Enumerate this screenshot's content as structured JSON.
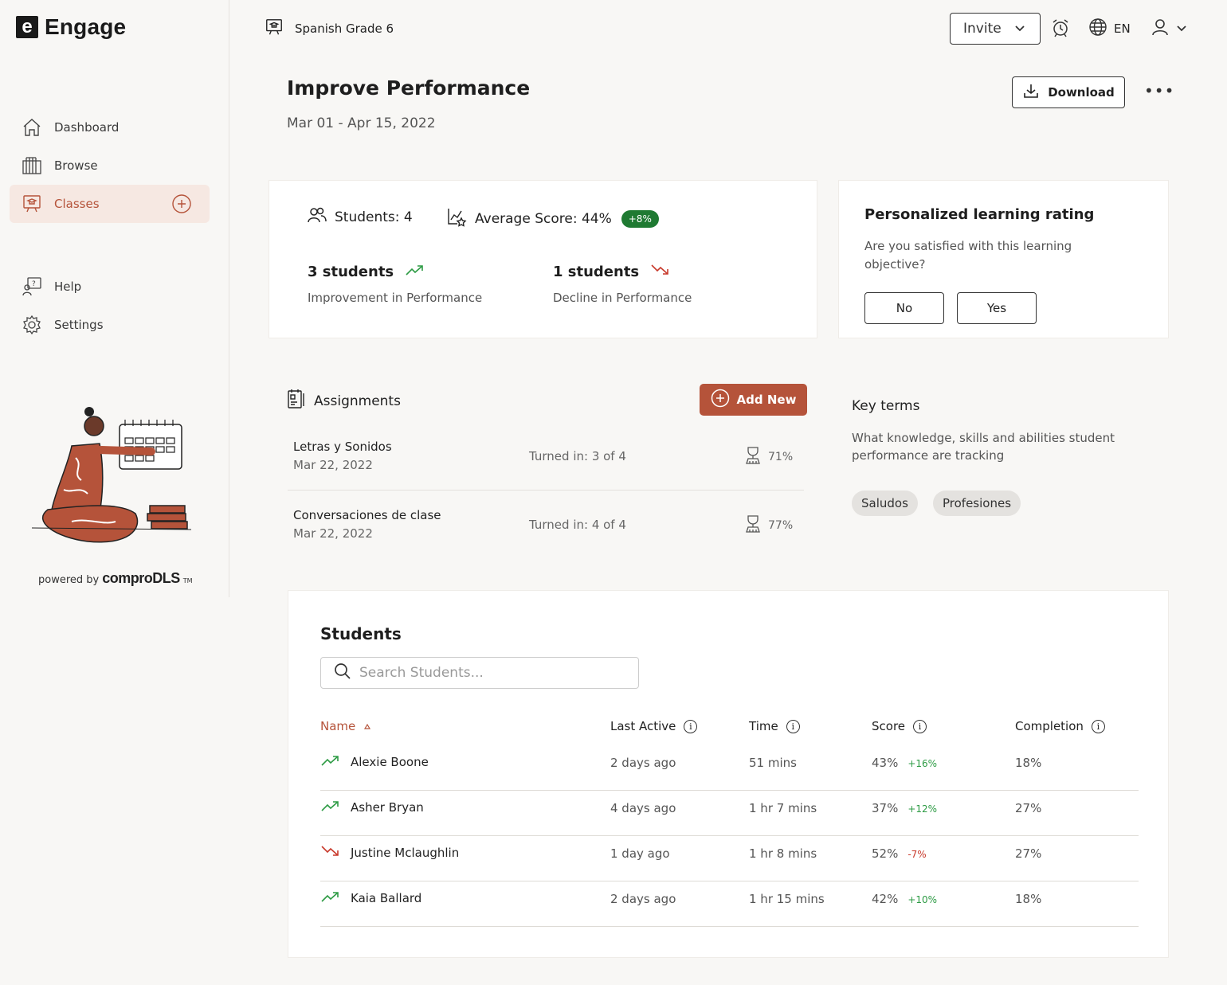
{
  "app": {
    "logo_mark": "e",
    "name": "Engage"
  },
  "sidebar": {
    "items": [
      {
        "label": "Dashboard",
        "icon": "home-icon"
      },
      {
        "label": "Browse",
        "icon": "books-icon"
      },
      {
        "label": "Classes",
        "icon": "classroom-icon",
        "active": true
      },
      {
        "label": "Help",
        "icon": "help-icon"
      },
      {
        "label": "Settings",
        "icon": "gear-icon"
      }
    ],
    "powered_by": "powered by",
    "brand": "comproDLS",
    "trademark": "TM"
  },
  "topbar": {
    "class_name": "Spanish Grade 6",
    "invite_label": "Invite",
    "language": "EN"
  },
  "header": {
    "title": "Improve Performance",
    "date_range": "Mar 01 - Apr 15, 2022",
    "download_label": "Download",
    "more_label": "•••"
  },
  "stats": {
    "students_label": "Students: 4",
    "avg_score_label": "Average Score: 44%",
    "avg_delta": "+8%",
    "improved_count": "3 students",
    "improved_label": "Improvement in Performance",
    "declined_count": "1 students",
    "declined_label": "Decline in Performance"
  },
  "rating": {
    "title": "Personalized learning rating",
    "question": "Are you satisfied with this learning objective?",
    "no_label": "No",
    "yes_label": "Yes"
  },
  "assignments": {
    "title": "Assignments",
    "add_label": "Add New",
    "rows": [
      {
        "title": "Letras y Sonidos",
        "date": "Mar 22, 2022",
        "turned_in": "Turned in: 3 of 4",
        "score": "71%"
      },
      {
        "title": "Conversaciones de clase",
        "date": "Mar 22, 2022",
        "turned_in": "Turned in: 4 of 4",
        "score": "77%"
      }
    ]
  },
  "key_terms": {
    "title": "Key terms",
    "description": "What knowledge, skills and abilities student performance are tracking",
    "chips": [
      "Saludos",
      "Profesiones"
    ]
  },
  "students": {
    "title": "Students",
    "search_placeholder": "Search Students...",
    "columns": {
      "name": "Name",
      "last_active": "Last Active",
      "time": "Time",
      "score": "Score",
      "completion": "Completion"
    },
    "rows": [
      {
        "name": "Alexie Boone",
        "trend": "up",
        "last_active": "2 days ago",
        "time": "51 mins",
        "score": "43%",
        "delta": "+16%",
        "completion": "18%"
      },
      {
        "name": "Asher Bryan",
        "trend": "up",
        "last_active": "4 days ago",
        "time": "1 hr 7 mins",
        "score": "37%",
        "delta": "+12%",
        "completion": "27%"
      },
      {
        "name": "Justine Mclaughlin",
        "trend": "down",
        "last_active": "1 day ago",
        "time": "1 hr 8 mins",
        "score": "52%",
        "delta": "-7%",
        "completion": "27%"
      },
      {
        "name": "Kaia Ballard",
        "trend": "up",
        "last_active": "2 days ago",
        "time": "1 hr 15 mins",
        "score": "42%",
        "delta": "+10%",
        "completion": "18%"
      }
    ]
  },
  "colors": {
    "accent": "#b5533a",
    "accent_light": "#f6e8e2",
    "positive": "#2d9b44",
    "negative": "#c8392b",
    "badge": "#1f7a32"
  }
}
